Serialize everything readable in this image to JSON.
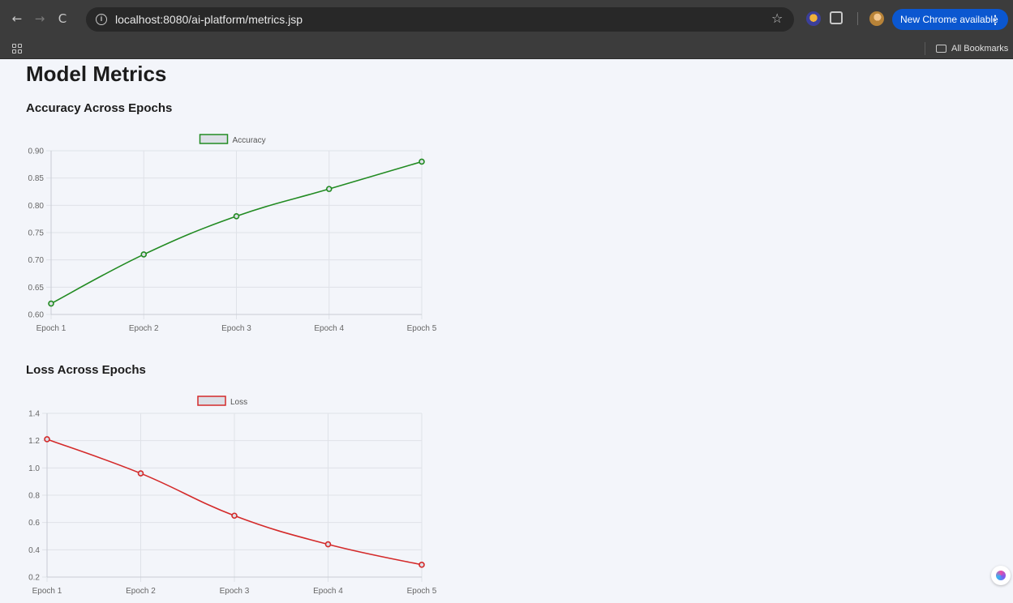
{
  "browser": {
    "url": "localhost:8080/ai-platform/metrics.jsp",
    "update_label": "New Chrome available",
    "bookmarks_label": "All Bookmarks",
    "back_icon": "←",
    "forward_icon": "→",
    "reload_icon": "C",
    "star_icon": "☆"
  },
  "page": {
    "title": "Model Metrics",
    "accuracy_heading": "Accuracy Across Epochs",
    "loss_heading": "Loss Across Epochs"
  },
  "chart_data": [
    {
      "type": "line",
      "categories": [
        "Epoch 1",
        "Epoch 2",
        "Epoch 3",
        "Epoch 4",
        "Epoch 5"
      ],
      "series": [
        {
          "name": "Accuracy",
          "values": [
            0.62,
            0.71,
            0.78,
            0.83,
            0.88
          ],
          "color": "#228b22"
        }
      ],
      "ylim": [
        0.6,
        0.9
      ],
      "yticks": [
        0.9,
        0.85,
        0.8,
        0.75,
        0.7,
        0.65,
        0.6
      ],
      "ytick_labels": [
        "0.90",
        "0.85",
        "0.80",
        "0.75",
        "0.70",
        "0.65",
        "0.60"
      ],
      "grid": true,
      "legend": "top-center"
    },
    {
      "type": "line",
      "categories": [
        "Epoch 1",
        "Epoch 2",
        "Epoch 3",
        "Epoch 4",
        "Epoch 5"
      ],
      "series": [
        {
          "name": "Loss",
          "values": [
            1.21,
            0.96,
            0.65,
            0.44,
            0.29
          ],
          "color": "#d42a2a"
        }
      ],
      "ylim": [
        0.2,
        1.4
      ],
      "yticks": [
        1.4,
        1.2,
        1.0,
        0.8,
        0.6,
        0.4,
        0.2
      ],
      "ytick_labels": [
        "1.4",
        "1.2",
        "1.0",
        "0.8",
        "0.6",
        "0.4",
        "0.2"
      ],
      "grid": true,
      "legend": "top-center"
    }
  ]
}
